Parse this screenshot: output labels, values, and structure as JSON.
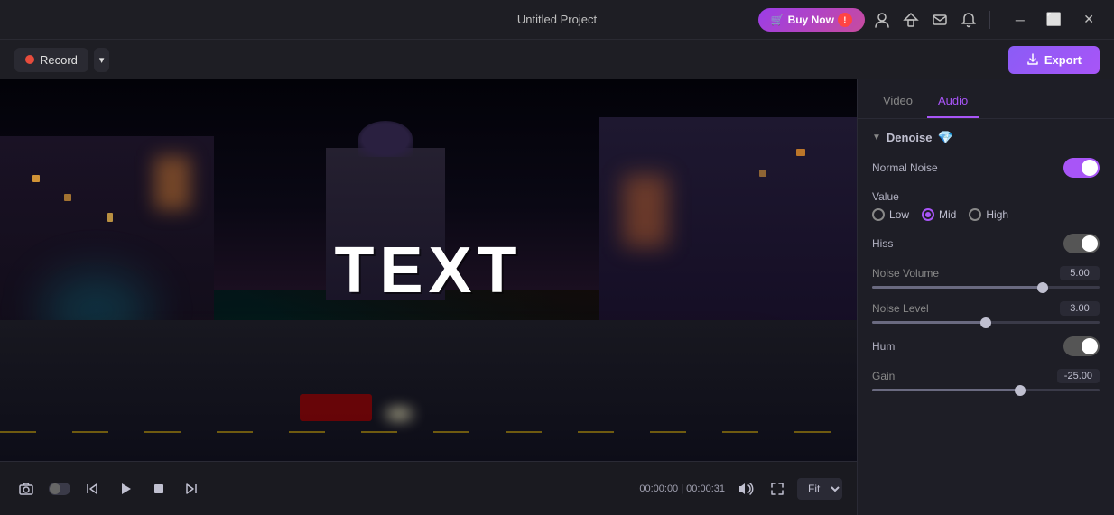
{
  "titleBar": {
    "title": "Untitled Project",
    "buyNow": "Buy Now",
    "icons": [
      "user",
      "hat",
      "mail",
      "bell"
    ],
    "winControls": [
      "minimize",
      "maximize",
      "close"
    ]
  },
  "toolbar": {
    "record": "Record",
    "export": "Export"
  },
  "video": {
    "overlay_text": "TEXT",
    "time_current": "00:00:00",
    "time_total": "00:00:31",
    "fit_option": "Fit"
  },
  "panel": {
    "tabs": [
      {
        "id": "video",
        "label": "Video",
        "active": false
      },
      {
        "id": "audio",
        "label": "Audio",
        "active": true
      }
    ],
    "denoise": {
      "section_label": "Denoise",
      "normal_noise_label": "Normal Noise",
      "normal_noise_on": true,
      "value_label": "Value",
      "radio_options": [
        "Low",
        "Mid",
        "High"
      ],
      "radio_selected": "Mid",
      "hiss_label": "Hiss",
      "hiss_on": true,
      "noise_volume_label": "Noise Volume",
      "noise_volume_value": "5.00",
      "noise_volume_pct": 75,
      "noise_level_label": "Noise Level",
      "noise_level_value": "3.00",
      "noise_level_pct": 50,
      "hum_label": "Hum",
      "hum_on": true,
      "gain_label": "Gain",
      "gain_value": "-25.00",
      "gain_pct": 65
    }
  }
}
